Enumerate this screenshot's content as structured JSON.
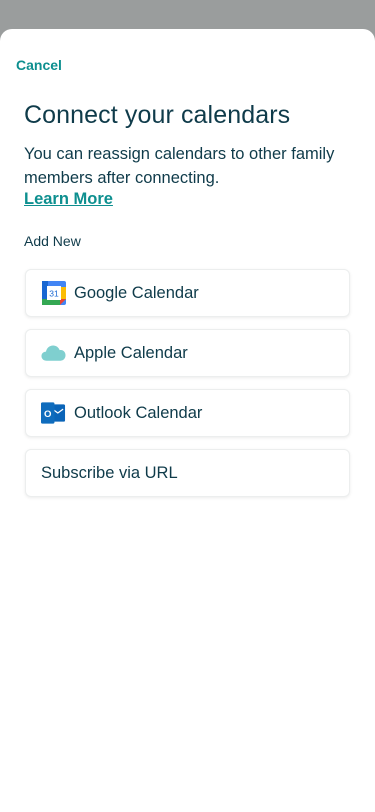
{
  "header": {
    "cancel_label": "Cancel"
  },
  "main": {
    "title": "Connect your calendars",
    "subtitle": "You can reassign calendars to other family members after connecting.",
    "learn_more": "Learn More",
    "section_label": "Add New",
    "options": [
      {
        "label": "Google Calendar",
        "icon": "google-calendar-icon",
        "icon_text": "31"
      },
      {
        "label": "Apple Calendar",
        "icon": "icloud-icon"
      },
      {
        "label": "Outlook Calendar",
        "icon": "outlook-icon",
        "icon_text": "O"
      },
      {
        "label": "Subscribe via URL"
      }
    ]
  },
  "colors": {
    "accent": "#0d8f8f",
    "text": "#0f3b4a",
    "overlay": "#9a9d9d"
  }
}
